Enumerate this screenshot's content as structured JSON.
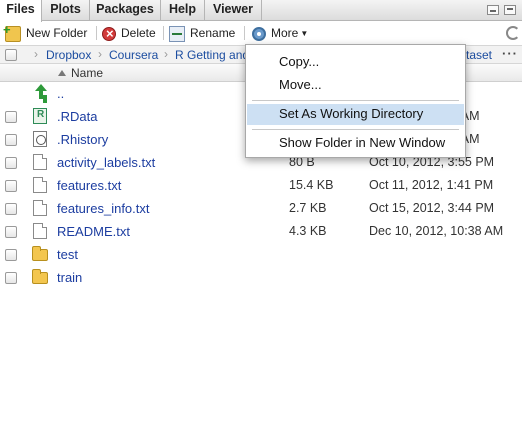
{
  "tabs": [
    {
      "label": "Files",
      "active": true
    },
    {
      "label": "Plots",
      "active": false
    },
    {
      "label": "Packages",
      "active": false
    },
    {
      "label": "Help",
      "active": false
    },
    {
      "label": "Viewer",
      "active": false
    }
  ],
  "toolbar": {
    "new_folder": "New Folder",
    "delete": "Delete",
    "rename": "Rename",
    "more": "More"
  },
  "breadcrumb": {
    "items": [
      "Dropbox",
      "Coursera",
      "R Getting and"
    ],
    "trailing": "taset",
    "overflow": "···"
  },
  "header": {
    "name": "Name"
  },
  "rows": [
    {
      "name": "..",
      "icon": "parent-dir-icon",
      "size": "",
      "modified": ""
    },
    {
      "name": ".RData",
      "icon": "rdata-file-icon",
      "size": "",
      "modified": "9 AM"
    },
    {
      "name": ".Rhistory",
      "icon": "rhistory-file-icon",
      "size": "",
      "modified": "9 AM"
    },
    {
      "name": "activity_labels.txt",
      "icon": "text-file-icon",
      "size": "80 B",
      "modified": "Oct 10, 2012, 3:55 PM"
    },
    {
      "name": "features.txt",
      "icon": "text-file-icon",
      "size": "15.4 KB",
      "modified": "Oct 11, 2012, 1:41 PM"
    },
    {
      "name": "features_info.txt",
      "icon": "text-file-icon",
      "size": "2.7 KB",
      "modified": "Oct 15, 2012, 3:44 PM"
    },
    {
      "name": "README.txt",
      "icon": "text-file-icon",
      "size": "4.3 KB",
      "modified": "Dec 10, 2012, 10:38 AM"
    },
    {
      "name": "test",
      "icon": "folder-icon",
      "size": "",
      "modified": ""
    },
    {
      "name": "train",
      "icon": "folder-icon",
      "size": "",
      "modified": ""
    }
  ],
  "more_menu": {
    "items": [
      "Copy...",
      "Move...",
      "Set As Working Directory",
      "Show Folder in New Window"
    ],
    "highlighted": "Set As Working Directory"
  },
  "colors": {
    "link": "#1c3da0",
    "menu_highlight": "#cde0f3"
  }
}
